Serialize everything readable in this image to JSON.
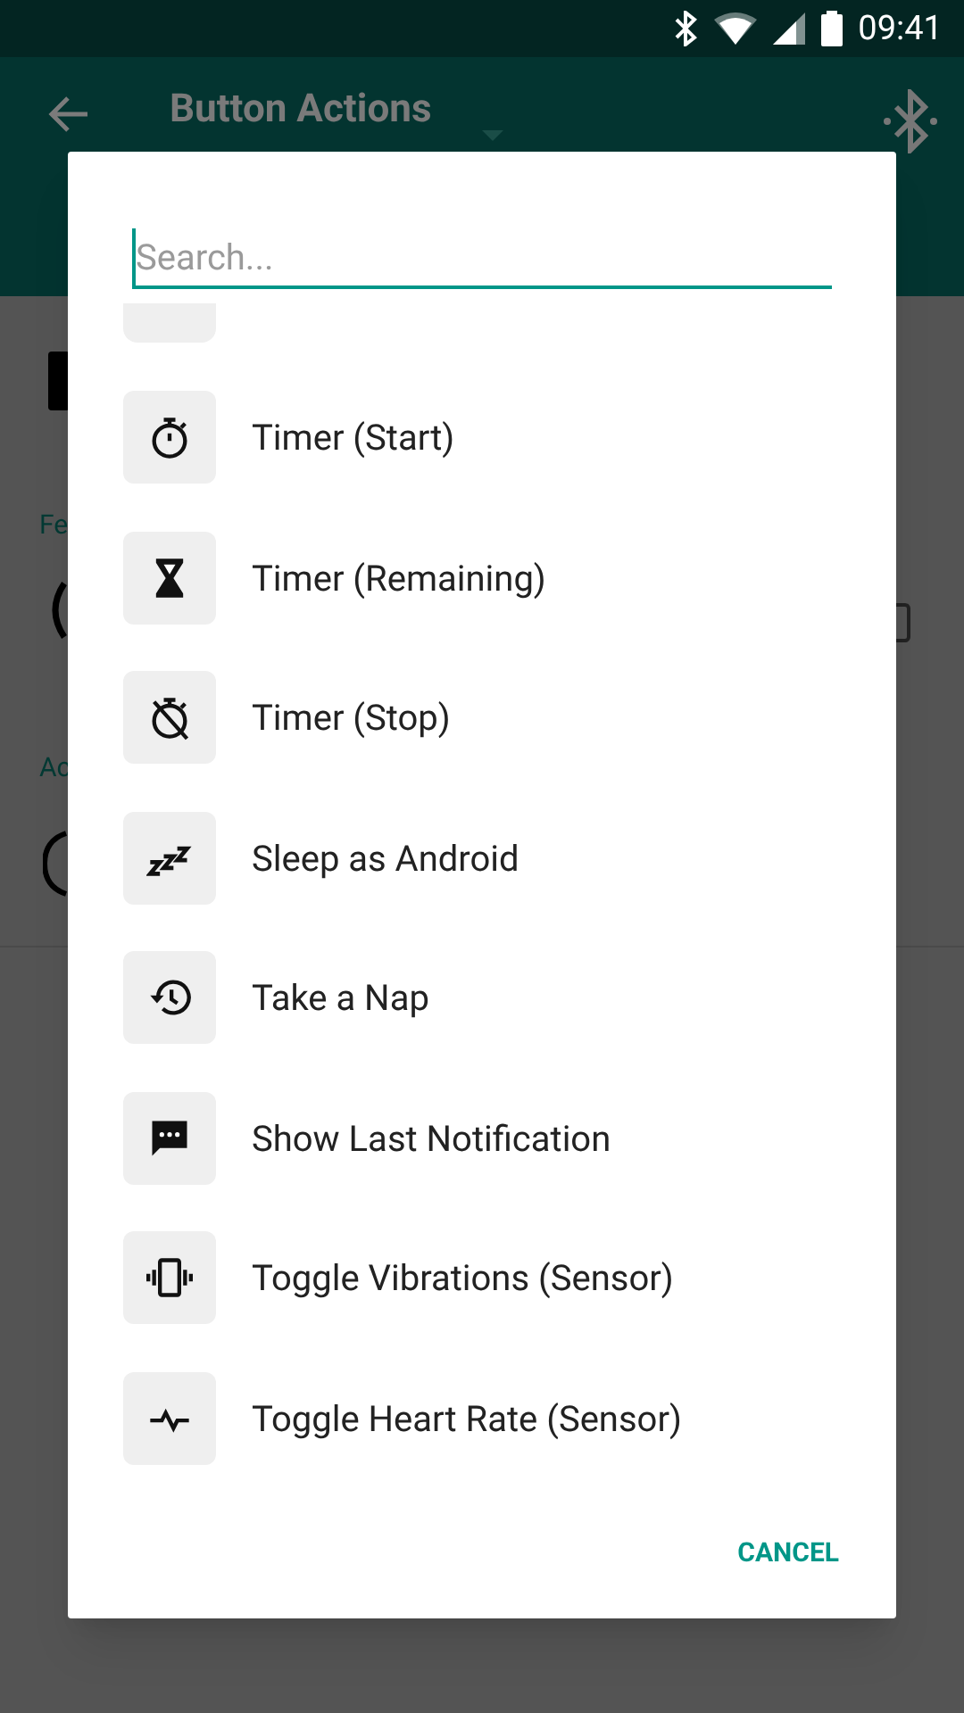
{
  "status_bar": {
    "time": "09:41"
  },
  "toolbar": {
    "title": "Button Actions"
  },
  "background": {
    "section_labels": [
      "Fe",
      "Ac"
    ]
  },
  "dialog": {
    "search": {
      "placeholder": "Search..."
    },
    "items": [
      {
        "label": "Timer (Start)"
      },
      {
        "label": "Timer (Remaining)"
      },
      {
        "label": "Timer (Stop)"
      },
      {
        "label": "Sleep as Android"
      },
      {
        "label": "Take a Nap"
      },
      {
        "label": "Show Last Notification"
      },
      {
        "label": "Toggle Vibrations (Sensor)"
      },
      {
        "label": "Toggle Heart Rate (Sensor)"
      }
    ],
    "buttons": [
      "CANCEL"
    ]
  }
}
